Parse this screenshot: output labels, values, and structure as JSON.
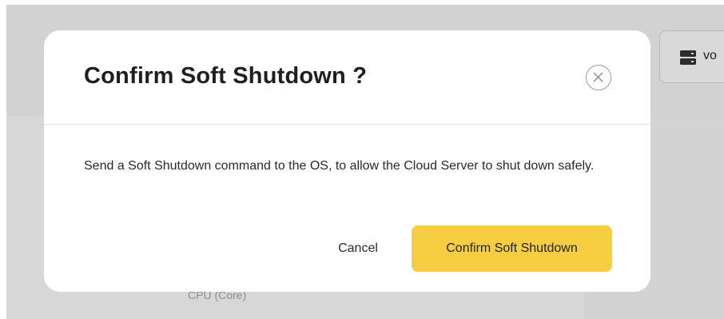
{
  "background": {
    "volume_label": "vo",
    "volume_icon": "server-stack-icon",
    "cpu_label": "CPU (Core)"
  },
  "modal": {
    "title": "Confirm Soft Shutdown ?",
    "close_icon": "close-circle-icon",
    "body": "Send a Soft Shutdown command to the OS, to allow the Cloud Server to shut down safely.",
    "cancel_label": "Cancel",
    "confirm_label": "Confirm Soft Shutdown"
  },
  "colors": {
    "accent": "#f7ce42",
    "overlay": "#d7d7d7",
    "title_text": "#1f1f1f"
  }
}
